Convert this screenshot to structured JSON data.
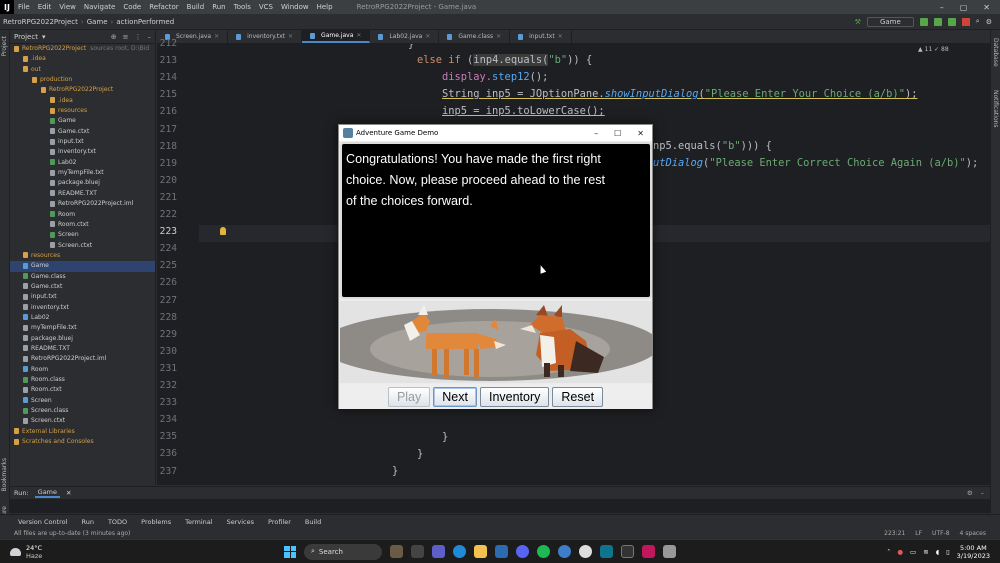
{
  "menubar": {
    "logo": "IJ",
    "items": [
      "File",
      "Edit",
      "View",
      "Navigate",
      "Code",
      "Refactor",
      "Build",
      "Run",
      "Tools",
      "VCS",
      "Window",
      "Help"
    ],
    "title": "RetroRPG2022Project - Game.java",
    "win_min": "–",
    "win_max": "▢",
    "win_close": "✕"
  },
  "navbar": {
    "crumbs": [
      "RetroRPG2022Project",
      "Game",
      "actionPerformed"
    ],
    "run_config": "Game"
  },
  "project": {
    "header": "Project",
    "tree": [
      {
        "label": "RetroRPG2022Project",
        "note": "sources root, D:\\Bid",
        "kind": "dir",
        "indent": 0
      },
      {
        "label": ".idea",
        "kind": "dir",
        "indent": 1
      },
      {
        "label": "out",
        "kind": "dir",
        "indent": 1
      },
      {
        "label": "production",
        "kind": "dir",
        "indent": 2
      },
      {
        "label": "RetroRPG2022Project",
        "kind": "dir",
        "indent": 3
      },
      {
        "label": ".idea",
        "kind": "dir",
        "indent": 4
      },
      {
        "label": "resources",
        "kind": "dir",
        "indent": 4
      },
      {
        "label": "Game",
        "kind": "cls",
        "indent": 4
      },
      {
        "label": "Game.ctxt",
        "kind": "txt",
        "indent": 4
      },
      {
        "label": "input.txt",
        "kind": "txt",
        "indent": 4
      },
      {
        "label": "inventory.txt",
        "kind": "txt",
        "indent": 4
      },
      {
        "label": "Lab02",
        "kind": "cls",
        "indent": 4
      },
      {
        "label": "myTempFile.txt",
        "kind": "txt",
        "indent": 4
      },
      {
        "label": "package.bluej",
        "kind": "txt",
        "indent": 4
      },
      {
        "label": "README.TXT",
        "kind": "txt",
        "indent": 4
      },
      {
        "label": "RetroRPG2022Project.iml",
        "kind": "txt",
        "indent": 4
      },
      {
        "label": "Room",
        "kind": "cls",
        "indent": 4
      },
      {
        "label": "Room.ctxt",
        "kind": "txt",
        "indent": 4
      },
      {
        "label": "Screen",
        "kind": "cls",
        "indent": 4
      },
      {
        "label": "Screen.ctxt",
        "kind": "txt",
        "indent": 4
      },
      {
        "label": "resources",
        "kind": "dir",
        "indent": 1
      },
      {
        "label": "Game",
        "kind": "java",
        "indent": 1,
        "selected": true
      },
      {
        "label": "Game.class",
        "kind": "cls",
        "indent": 1
      },
      {
        "label": "Game.ctxt",
        "kind": "txt",
        "indent": 1
      },
      {
        "label": "input.txt",
        "kind": "txt",
        "indent": 1
      },
      {
        "label": "inventory.txt",
        "kind": "txt",
        "indent": 1
      },
      {
        "label": "Lab02",
        "kind": "java",
        "indent": 1
      },
      {
        "label": "myTempFile.txt",
        "kind": "txt",
        "indent": 1
      },
      {
        "label": "package.bluej",
        "kind": "txt",
        "indent": 1
      },
      {
        "label": "README.TXT",
        "kind": "txt",
        "indent": 1
      },
      {
        "label": "RetroRPG2022Project.iml",
        "kind": "txt",
        "indent": 1
      },
      {
        "label": "Room",
        "kind": "java",
        "indent": 1
      },
      {
        "label": "Room.class",
        "kind": "cls",
        "indent": 1
      },
      {
        "label": "Room.ctxt",
        "kind": "txt",
        "indent": 1
      },
      {
        "label": "Screen",
        "kind": "java",
        "indent": 1
      },
      {
        "label": "Screen.class",
        "kind": "cls",
        "indent": 1
      },
      {
        "label": "Screen.ctxt",
        "kind": "txt",
        "indent": 1
      },
      {
        "label": "External Libraries",
        "kind": "dir",
        "indent": 0
      },
      {
        "label": "Scratches and Consoles",
        "kind": "dir",
        "indent": 0
      }
    ]
  },
  "tabs": [
    {
      "label": "Screen.java",
      "active": false
    },
    {
      "label": "inventory.txt",
      "active": false
    },
    {
      "label": "Game.java",
      "active": true
    },
    {
      "label": "Lab02.java",
      "active": false
    },
    {
      "label": "Game.class",
      "active": false
    },
    {
      "label": "input.txt",
      "active": false
    }
  ],
  "editor": {
    "line_numbers": [
      "212",
      "213",
      "214",
      "215",
      "216",
      "217",
      "218",
      "219",
      "220",
      "221",
      "222",
      "223",
      "224",
      "225",
      "226",
      "227",
      "228",
      "229",
      "230",
      "231",
      "232",
      "233",
      "234",
      "235",
      "236",
      "237"
    ],
    "current_line": "223",
    "inspections": "▲ 11  ✓ 88",
    "code": {
      "l212": "}",
      "l213_kw": "else if",
      "l213_a": " (",
      "l213_hl": "inp4.equals(",
      "l213_st": "\"b\"",
      "l213_b": ")) {",
      "l214_a": "display.",
      "l214_fn": "step12",
      "l214_b": "();",
      "l215_a": "String inp5 = JOptionPane.",
      "l215_fn": "showInputDialog",
      "l215_b": "(",
      "l215_st": "\"Please Enter Your Choice (a/b)\"",
      "l215_c": ");",
      "l216": "inp5 = inp5.toLowerCase();",
      "l218_a": "np5.equals(",
      "l218_st": "\"b\"",
      "l218_b": "))) {",
      "l219_fn": "utDialog",
      "l219_a": "(",
      "l219_st": "\"Please Enter Correct Choice Again (a/b)\"",
      "l219_b": ");",
      "l235": "}",
      "l236": "}",
      "l237": "}"
    }
  },
  "app_window": {
    "title": "Adventure Game Demo",
    "min": "–",
    "max": "☐",
    "close": "✕",
    "text_lines": [
      "Congratulations! You have made the first right",
      "choice. Now, please proceed ahead to the rest",
      "of the choices forward."
    ],
    "buttons": {
      "play": "Play",
      "next": "Next",
      "inventory": "Inventory",
      "reset": "Reset"
    }
  },
  "runbar": {
    "label": "Run:",
    "tab": "Game"
  },
  "toolwindows": [
    "Version Control",
    "Run",
    "TODO",
    "Problems",
    "Terminal",
    "Services",
    "Profiler",
    "Build"
  ],
  "statusbar": {
    "message": "All files are up-to-date (3 minutes ago)",
    "position": "223:21",
    "line_sep": "LF",
    "encoding": "UTF-8",
    "indent": "4 spaces"
  },
  "left_tools": {
    "project": "Project",
    "bookmarks": "Bookmarks",
    "structure": "Structure"
  },
  "right_tools": {
    "database": "Database",
    "notifications": "Notifications"
  },
  "taskbar": {
    "weather_temp": "24°C",
    "weather_desc": "Haze",
    "search_label": "Search",
    "time": "5:00 AM",
    "date": "3/19/2023"
  }
}
